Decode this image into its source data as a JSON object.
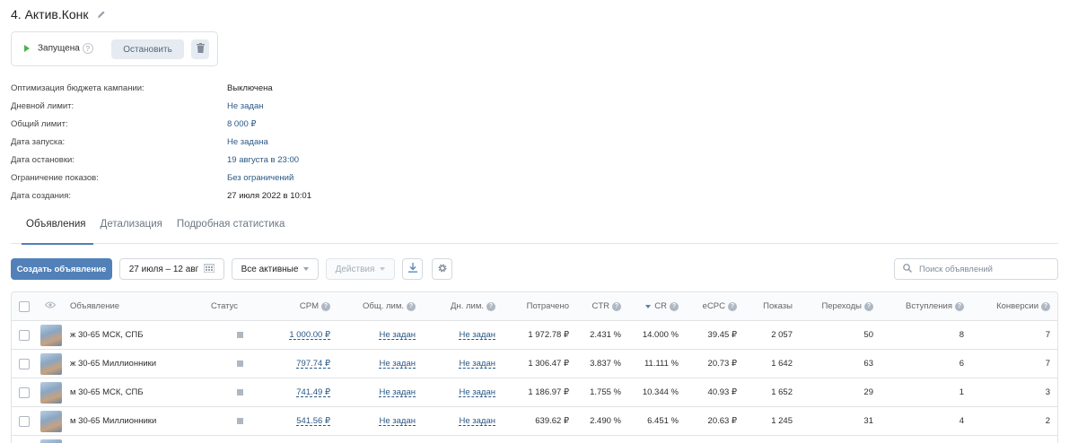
{
  "campaign": {
    "title": "4. Актив.Конк"
  },
  "status": {
    "label": "Запущена",
    "help": "?",
    "stop_label": "Остановить"
  },
  "info": [
    {
      "key": "Оптимизация бюджета кампании:",
      "value": "Выключена",
      "style": "plain"
    },
    {
      "key": "Дневной лимит:",
      "value": "Не задан",
      "style": "blue"
    },
    {
      "key": "Общий лимит:",
      "value": "8 000 ₽",
      "style": "blue"
    },
    {
      "key": "Дата запуска:",
      "value": "Не задана",
      "style": "blue"
    },
    {
      "key": "Дата остановки:",
      "value": "19 августа в 23:00",
      "style": "blue"
    },
    {
      "key": "Ограничение показов:",
      "value": "Без ограничений",
      "style": "blue"
    },
    {
      "key": "Дата создания:",
      "value": "27 июля 2022 в 10:01",
      "style": "plain"
    }
  ],
  "tabs": [
    {
      "label": "Объявления",
      "active": true
    },
    {
      "label": "Детализация",
      "active": false
    },
    {
      "label": "Подробная статистика",
      "active": false
    }
  ],
  "toolbar": {
    "create_label": "Создать объявление",
    "date_range": "27 июля – 12 авг",
    "filter_label": "Все активные",
    "actions_label": "Действия",
    "search_placeholder": "Поиск объявлений"
  },
  "table": {
    "columns": {
      "ad": "Объявление",
      "status": "Статус",
      "cpm": "CPM",
      "total_limit": "Общ. лим.",
      "day_limit": "Дн. лим.",
      "spent": "Потрачено",
      "ctr": "CTR",
      "cr": "CR",
      "ecpc": "eCPC",
      "impressions": "Показы",
      "clicks": "Переходы",
      "joins": "Вступления",
      "conversions": "Конверсии"
    },
    "rows": [
      {
        "name": "ж 30-65 МСК, СПБ",
        "cpm": "1 000.00 ₽",
        "total_limit": "Не задан",
        "day_limit": "Не задан",
        "spent": "1 972.78 ₽",
        "ctr": "2.431 %",
        "cr": "14.000 %",
        "ecpc": "39.45 ₽",
        "impressions": "2 057",
        "clicks": "50",
        "joins": "8",
        "conversions": "7"
      },
      {
        "name": "ж 30-65 Миллионники",
        "cpm": "797.74 ₽",
        "total_limit": "Не задан",
        "day_limit": "Не задан",
        "spent": "1 306.47 ₽",
        "ctr": "3.837 %",
        "cr": "11.111 %",
        "ecpc": "20.73 ₽",
        "impressions": "1 642",
        "clicks": "63",
        "joins": "6",
        "conversions": "7"
      },
      {
        "name": "м 30-65 МСК, СПБ",
        "cpm": "741.49 ₽",
        "total_limit": "Не задан",
        "day_limit": "Не задан",
        "spent": "1 186.97 ₽",
        "ctr": "1.755 %",
        "cr": "10.344 %",
        "ecpc": "40.93 ₽",
        "impressions": "1 652",
        "clicks": "29",
        "joins": "1",
        "conversions": "3"
      },
      {
        "name": "м 30-65 Миллионники",
        "cpm": "541.56 ₽",
        "total_limit": "Не задан",
        "day_limit": "Не задан",
        "spent": "639.62 ₽",
        "ctr": "2.490 %",
        "cr": "6.451 %",
        "ecpc": "20.63 ₽",
        "impressions": "1 245",
        "clicks": "31",
        "joins": "4",
        "conversions": "2"
      }
    ]
  }
}
